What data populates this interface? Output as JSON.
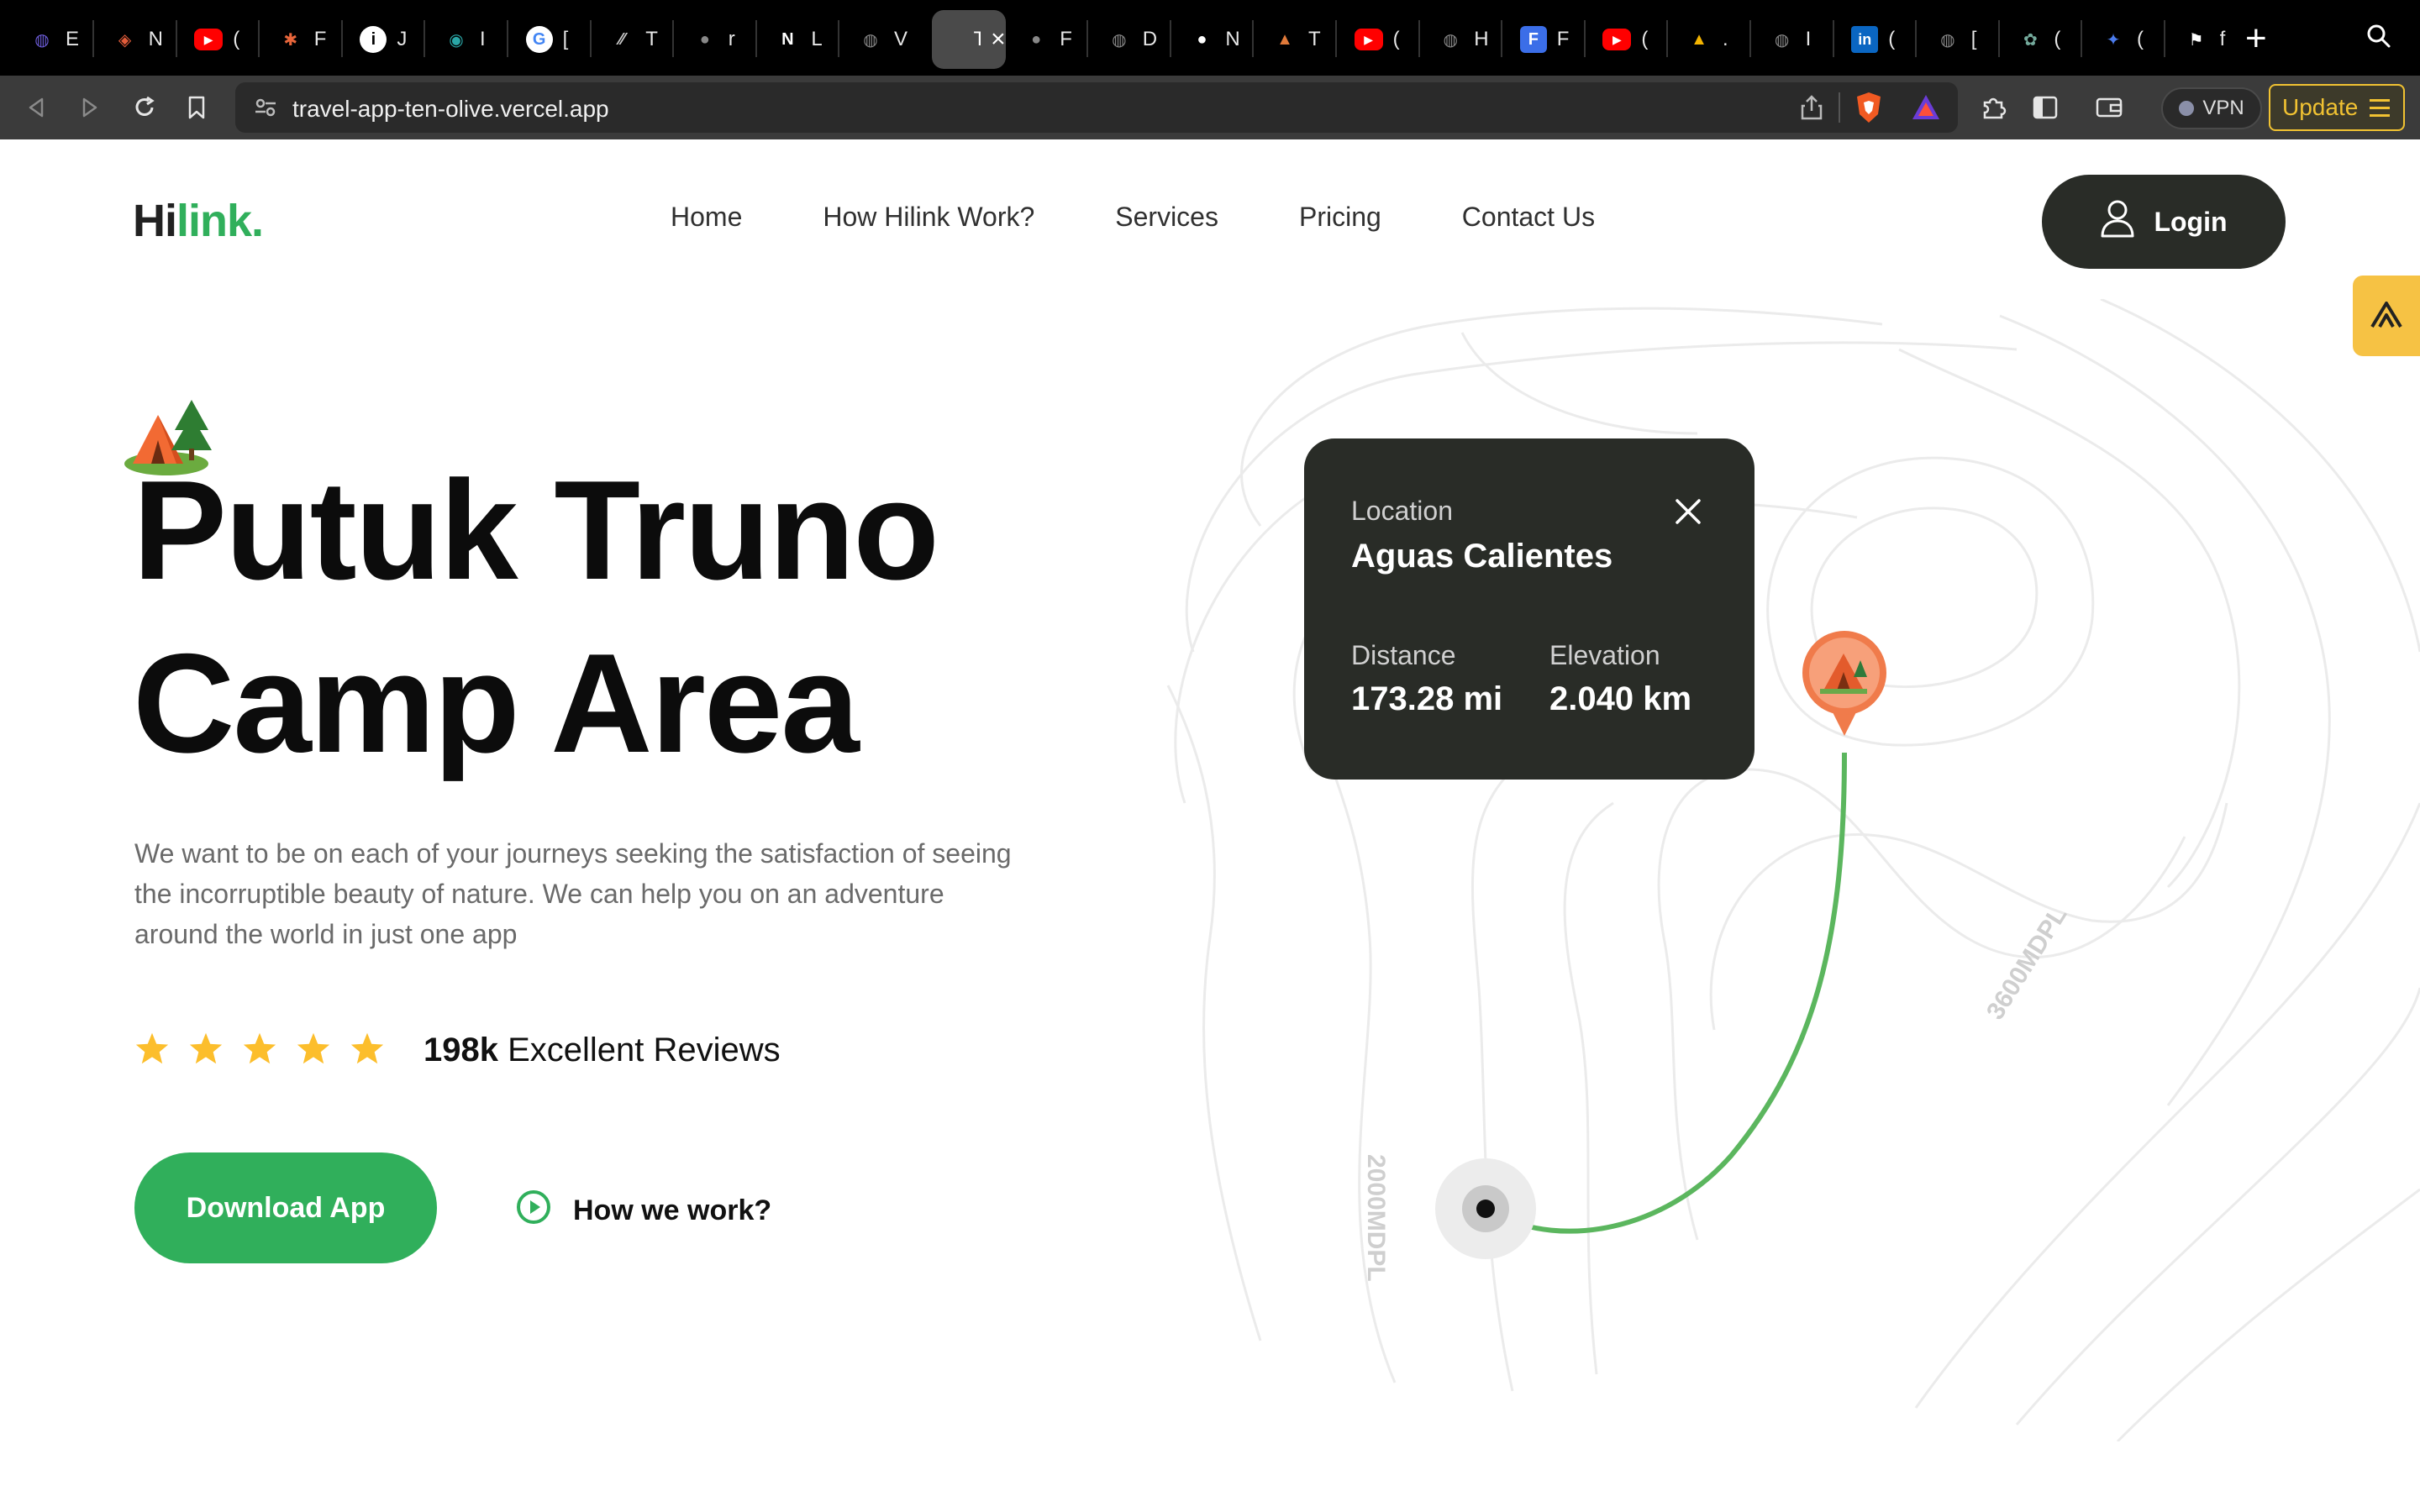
{
  "browser": {
    "tabs": [
      {
        "title": "E",
        "icon": "globe-icon",
        "color": "#6b5bd6"
      },
      {
        "title": "N",
        "icon": "shield-icon",
        "color": "#e25c3a"
      },
      {
        "title": "(",
        "icon": "youtube-icon",
        "color": "#ff0000"
      },
      {
        "title": "F",
        "icon": "figma-icon",
        "color": "#e8663b"
      },
      {
        "title": "J",
        "icon": "info-icon",
        "color": "#ffffff"
      },
      {
        "title": "I",
        "icon": "eye-icon",
        "color": "#2aa6a6"
      },
      {
        "title": "[",
        "icon": "google-icon",
        "color": "#ffffff"
      },
      {
        "title": "T",
        "icon": "slash-icon",
        "color": "#cccccc"
      },
      {
        "title": "r",
        "icon": "github-icon",
        "color": "#888888"
      },
      {
        "title": "L",
        "icon": "n-icon",
        "color": "#ffffff"
      },
      {
        "title": "V",
        "icon": "globe-icon",
        "color": "#888888"
      },
      {
        "title": "T",
        "icon": "travel-icon",
        "color": "#4a4a4a",
        "active": true
      },
      {
        "title": "F",
        "icon": "github-icon",
        "color": "#888888"
      },
      {
        "title": "D",
        "icon": "globe-icon",
        "color": "#888888"
      },
      {
        "title": "N",
        "icon": "github-icon",
        "color": "#ffffff"
      },
      {
        "title": "T",
        "icon": "camp-icon",
        "color": "#e07a3a"
      },
      {
        "title": "(",
        "icon": "youtube-icon",
        "color": "#ff0000"
      },
      {
        "title": "H",
        "icon": "globe-icon",
        "color": "#888888"
      },
      {
        "title": "F",
        "icon": "form-icon",
        "color": "#3b6ee8"
      },
      {
        "title": "(",
        "icon": "youtube-icon",
        "color": "#ff0000"
      },
      {
        "title": ".",
        "icon": "drive-icon",
        "color": "#f4b400"
      },
      {
        "title": "I",
        "icon": "globe-icon",
        "color": "#888888"
      },
      {
        "title": "(",
        "icon": "linkedin-icon",
        "color": "#0a66c2"
      },
      {
        "title": "[",
        "icon": "globe-icon",
        "color": "#888888"
      },
      {
        "title": "(",
        "icon": "openai-icon",
        "color": "#74aa9c"
      },
      {
        "title": "(",
        "icon": "sparkle-icon",
        "color": "#4b7bec"
      },
      {
        "title": "f",
        "icon": "flag-icon",
        "color": "#ffffff"
      }
    ],
    "url": "travel-app-ten-olive.vercel.app",
    "vpn_label": "VPN",
    "update_label": "Update"
  },
  "site": {
    "logo_main": "Hi",
    "logo_accent": "link.",
    "nav": [
      "Home",
      "How Hilink Work?",
      "Services",
      "Pricing",
      "Contact Us"
    ],
    "login_label": "Login",
    "hero_title_line1": "Putuk Truno",
    "hero_title_line2": "Camp Area",
    "hero_description": "We want to be on each of your journeys seeking the satisfaction of seeing the incorruptible beauty of nature. We can help you on an adventure around the world in just one app",
    "rating_stars": 5,
    "reviews_count": "198k",
    "reviews_label": "Excellent Reviews",
    "download_label": "Download App",
    "how_label": "How we work?",
    "accent_color": "#30af5b",
    "dark_color": "#292c27"
  },
  "location_card": {
    "location_label": "Location",
    "location_value": "Aguas Calientes",
    "distance_label": "Distance",
    "distance_value": "173.28 mi",
    "elevation_label": "Elevation",
    "elevation_value": "2.040 km"
  },
  "map": {
    "contour_label_1": "3600MDPL",
    "contour_label_2": "2000MDPL"
  }
}
